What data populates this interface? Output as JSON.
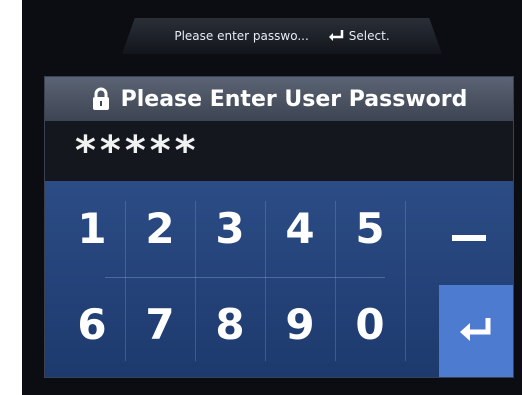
{
  "hint": {
    "text": "Please enter passwo...",
    "select_label": "Select.",
    "icon": "enter-arrow-icon"
  },
  "panel": {
    "title": "Please Enter User Password",
    "title_icon": "lock-icon",
    "password_mask": "*****"
  },
  "keypad": {
    "row1": [
      "1",
      "2",
      "3",
      "4",
      "5"
    ],
    "row2": [
      "6",
      "7",
      "8",
      "9",
      "0"
    ],
    "clear_icon": "minus-icon",
    "enter_icon": "enter-arrow-icon"
  },
  "colors": {
    "keypad": "#2c4c86",
    "enter_key": "#4c7bd0"
  }
}
